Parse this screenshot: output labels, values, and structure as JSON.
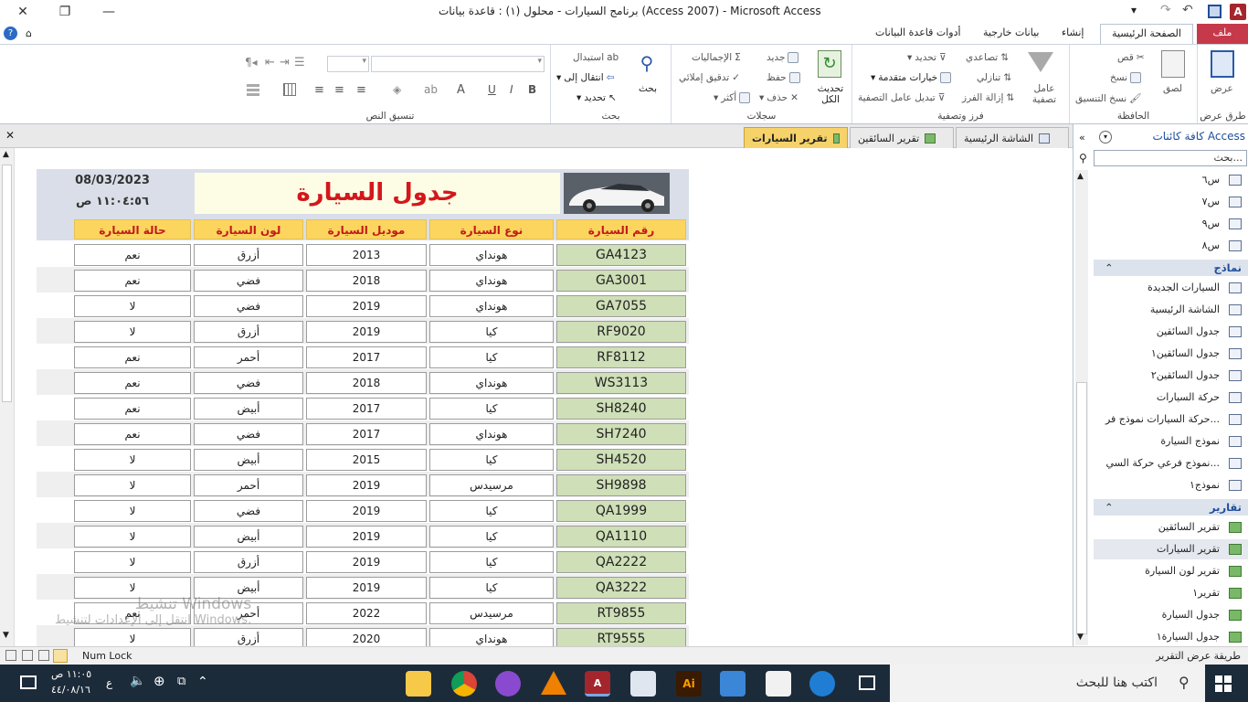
{
  "window": {
    "title": "برنامج السيارات - محلول (١) : قاعدة بيانات (Access 2007) - Microsoft Access"
  },
  "ribbon_tabs": [
    "ملف",
    "الصفحة الرئيسية",
    "إنشاء",
    "بيانات خارجية",
    "أدوات قاعدة البيانات"
  ],
  "ribbon": {
    "views_label": "عرض",
    "views_group": "طرق عرض",
    "clipboard": {
      "paste": "لصق",
      "cut": "قص",
      "copy": "نسخ",
      "format_painter": "نسخ التنسيق",
      "group": "الحافظة"
    },
    "sort_filter": {
      "filter": "عامل تصفية",
      "ascending": "تصاعدي",
      "descending": "تنازلي",
      "remove_sort": "إزالة الفرز",
      "selection": "تحديد",
      "advanced": "خيارات متقدمة",
      "toggle_filter": "تبديل عامل التصفية",
      "group": "فرز وتصفية"
    },
    "records": {
      "refresh": "تحديث الكل",
      "new": "جديد",
      "save": "حفظ",
      "delete": "حذف",
      "totals": "الإجماليات",
      "spelling": "تدقيق إملائي",
      "more": "أكثر",
      "group": "سجلات"
    },
    "find": {
      "find": "بحث",
      "replace": "استبدال",
      "goto": "انتقال إلى",
      "select": "تحديد",
      "group": "بحث"
    },
    "text_format": {
      "group": "تنسيق النص"
    }
  },
  "doc_tabs": [
    "الشاشة الرئيسية",
    "تقرير السائقين",
    "تقرير السيارات"
  ],
  "report": {
    "title": "جدول السيارة",
    "date": "08/03/2023",
    "time": "١١:٠٤:٥٦ ص",
    "columns": [
      "رقم السيارة",
      "نوع السيارة",
      "موديل السيارة",
      "لون السيارة",
      "حالة السيارة"
    ],
    "rows": [
      [
        "GA4123",
        "هونداي",
        "2013",
        "أزرق",
        "نعم"
      ],
      [
        "GA3001",
        "هونداي",
        "2018",
        "فضي",
        "نعم"
      ],
      [
        "GA7055",
        "هونداي",
        "2019",
        "فضي",
        "لا"
      ],
      [
        "RF9020",
        "كيا",
        "2019",
        "أزرق",
        "لا"
      ],
      [
        "RF8112",
        "كيا",
        "2017",
        "أحمر",
        "نعم"
      ],
      [
        "WS3113",
        "هونداي",
        "2018",
        "فضي",
        "نعم"
      ],
      [
        "SH8240",
        "كيا",
        "2017",
        "أبيض",
        "نعم"
      ],
      [
        "SH7240",
        "هونداي",
        "2017",
        "فضي",
        "نعم"
      ],
      [
        "SH4520",
        "كيا",
        "2015",
        "أبيض",
        "لا"
      ],
      [
        "SH9898",
        "مرسيدس",
        "2019",
        "أحمر",
        "لا"
      ],
      [
        "QA1999",
        "كيا",
        "2019",
        "فضي",
        "لا"
      ],
      [
        "QA1110",
        "كيا",
        "2019",
        "أبيض",
        "لا"
      ],
      [
        "QA2222",
        "كيا",
        "2019",
        "أزرق",
        "لا"
      ],
      [
        "QA3222",
        "كيا",
        "2019",
        "أبيض",
        "لا"
      ],
      [
        "RT9855",
        "مرسيدس",
        "2022",
        "أحمر",
        "نعم"
      ],
      [
        "RT9555",
        "هونداي",
        "2020",
        "أزرق",
        "لا"
      ]
    ]
  },
  "nav": {
    "header": "كافة كائنات Access",
    "search_placeholder": "بحث...",
    "queries": [
      "س٦",
      "س٧",
      "س٩",
      "س٨"
    ],
    "forms_label": "نماذج",
    "forms": [
      "السيارات الجديدة",
      "الشاشة الرئيسية",
      "جدول السائقين",
      "جدول السائقين١",
      "جدول السائقين٢",
      "حركة السيارات",
      "حركة السيارات نموذج فر...",
      "نموذج السيارة",
      "نموذج فرعي حركة السي...",
      "نموذج١"
    ],
    "reports_label": "تقارير",
    "reports": [
      "تقرير السائقين",
      "تقرير السيارات",
      "تقرير لون السيارة",
      "تقرير١",
      "جدول السيارة",
      "جدول السيارة١"
    ]
  },
  "status": {
    "left": "طريقة عرض التقرير",
    "numlock": "Num Lock"
  },
  "watermark": {
    "line1": "تنشيط Windows",
    "line2": "انتقل إلى الإعدادات لتنشيط Windows."
  },
  "taskbar": {
    "search_placeholder": "اكتب هنا للبحث",
    "time": "١١:٠٥ ص",
    "date": "٤٤/٠٨/١٦",
    "lang": "ع"
  }
}
